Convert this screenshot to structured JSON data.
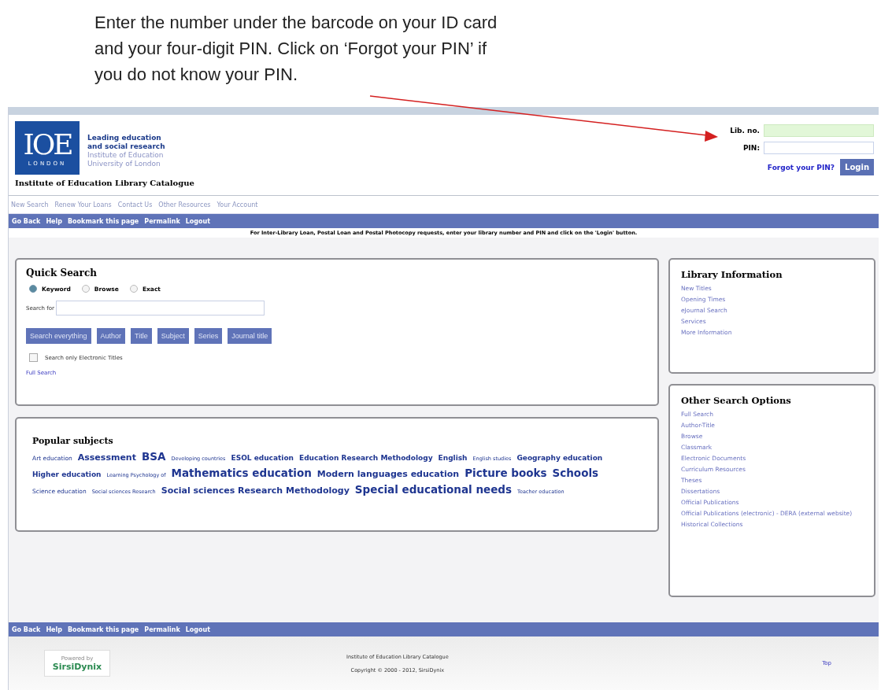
{
  "annotation": {
    "lines": [
      "Enter the number under the barcode on your ID card",
      "and your four-digit PIN.  Click on ‘Forgot your PIN’ if",
      "you do not know your PIN."
    ]
  },
  "header": {
    "logo": {
      "mark": "IOE",
      "city": "LONDON"
    },
    "tagline": [
      "Leading education",
      "and social research"
    ],
    "institution": [
      "Institute of Education",
      "University of London"
    ],
    "catalogue_title": "Institute of Education Library Catalogue"
  },
  "login": {
    "lib_no_label": "Lib. no.",
    "pin_label": "PIN:",
    "forgot_link": "Forgot your PIN?",
    "login_button": "Login"
  },
  "nav_links": [
    "New Search",
    "Renew Your Loans",
    "Contact Us",
    "Other Resources",
    "Your Account"
  ],
  "action_bar": [
    "Go Back",
    "Help",
    "Bookmark this page",
    "Permalink",
    "Logout"
  ],
  "notice": "For Inter-Library Loan, Postal Loan and Postal Photocopy requests, enter your library number and PIN and click on the 'Login' button.",
  "quick_search": {
    "title": "Quick Search",
    "modes": [
      {
        "label": "Keyword",
        "selected": true
      },
      {
        "label": "Browse",
        "selected": false
      },
      {
        "label": "Exact",
        "selected": false
      }
    ],
    "search_label": "Search for",
    "buttons": [
      "Search everything",
      "Author",
      "Title",
      "Subject",
      "Series",
      "Journal title"
    ],
    "electronic_only": {
      "label": "Search only Electronic Titles",
      "checked": false
    },
    "full_search_link": "Full Search"
  },
  "popular_subjects": {
    "title": "Popular subjects",
    "subjects": [
      {
        "label": "Art education",
        "kind": "small"
      },
      {
        "label": "Assessment",
        "kind": "large"
      },
      {
        "label": "BSA",
        "kind": "xlarge"
      },
      {
        "label": "Developing countries",
        "kind": "tiny"
      },
      {
        "label": "ESOL education",
        "kind": "medium"
      },
      {
        "label": "Education Research Methodology",
        "kind": "medium"
      },
      {
        "label": "English",
        "kind": "medium"
      },
      {
        "label": "English studies",
        "kind": "tiny"
      },
      {
        "label": "Geography education",
        "kind": "medium"
      },
      {
        "label": "Higher education",
        "kind": "medium"
      },
      {
        "label": "Learning Psychology of",
        "kind": "tiny"
      },
      {
        "label": "Mathematics education",
        "kind": "xlarge"
      },
      {
        "label": "Modern languages education",
        "kind": "large"
      },
      {
        "label": "Picture books",
        "kind": "xlarge"
      },
      {
        "label": "Schools",
        "kind": "xlarge"
      },
      {
        "label": "Science education",
        "kind": "small"
      },
      {
        "label": "Social sciences Research",
        "kind": "tiny"
      },
      {
        "label": "Social sciences Research Methodology",
        "kind": "large"
      },
      {
        "label": "Special educational needs",
        "kind": "xlarge"
      },
      {
        "label": "Teacher education",
        "kind": "tiny"
      }
    ]
  },
  "library_information": {
    "title": "Library Information",
    "links": [
      "New Titles",
      "Opening Times",
      "eJournal Search",
      "Services",
      "More Information"
    ]
  },
  "other_search_options": {
    "title": "Other Search Options",
    "links": [
      "Full Search",
      "Author-Title",
      "Browse",
      "Classmark",
      "Electronic Documents",
      "Curriculum Resources",
      "Theses",
      "Dissertations",
      "Official Publications",
      "Official Publications (electronic) - DERA (external website)",
      "Historical Collections"
    ]
  },
  "footer_bar": [
    "Go Back",
    "Help",
    "Bookmark this page",
    "Permalink",
    "Logout"
  ],
  "footer": {
    "powered_by": "Powered by",
    "vendor": "SirsiDynix",
    "catalogue": "Institute of Education Library Catalogue",
    "copyright": "Copyright © 2000 - 2012, SirsiDynix",
    "top_link": "Top"
  }
}
